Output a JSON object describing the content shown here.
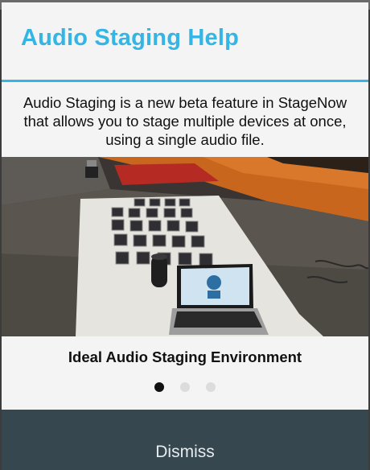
{
  "dialog": {
    "title": "Audio Staging Help",
    "description": "Audio Staging is a new beta feature in StageNow that allows you to stage multiple devices at once, using a single audio file.",
    "caption": "Ideal Audio Staging Environment",
    "pager": {
      "total": 3,
      "active": 1
    },
    "dismiss_label": "Dismiss",
    "colors": {
      "accent": "#33b5e5",
      "footer": "#37474f"
    }
  }
}
